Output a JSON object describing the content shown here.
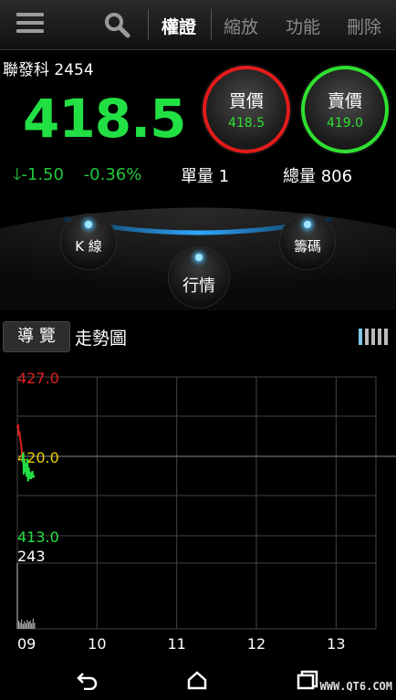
{
  "topbar": {
    "tabs": [
      {
        "label": "權證",
        "active": true
      },
      {
        "label": "縮放",
        "active": false
      },
      {
        "label": "功能",
        "active": false
      },
      {
        "label": "刪除",
        "active": false
      }
    ]
  },
  "quote": {
    "stock_name": "聯發科 2454",
    "price": "418.5",
    "change": "-1.50",
    "change_pct": "-0.36%",
    "single_volume": "單量 1",
    "total_volume": "總量 806",
    "price_color": "#22e044",
    "down_color": "#22c83c"
  },
  "buy": {
    "label": "買價",
    "value": "418.5",
    "ring_color": "#e31b1b"
  },
  "sell": {
    "label": "賣價",
    "value": "419.0",
    "ring_color": "#2fe02f"
  },
  "dial": {
    "kline": "K 線",
    "chips": "籌碼",
    "market": "行情"
  },
  "section": {
    "guide_label": "導 覽",
    "chart_title": "走勢圖"
  },
  "chart_data": {
    "type": "line",
    "x_ticks": [
      "09",
      "10",
      "11",
      "12",
      "13"
    ],
    "price_ticks": [
      {
        "label": "427.0",
        "value": 427.0,
        "color": "#e02020"
      },
      {
        "label": "420.0",
        "value": 420.0,
        "color": "#e8d000"
      },
      {
        "label": "413.0",
        "value": 413.0,
        "color": "#22e044"
      }
    ],
    "ylim": [
      413.0,
      427.0
    ],
    "reference_price": 420.0,
    "volume_max_label": "243",
    "price_series": [
      {
        "t": 0.0,
        "v": 422.5
      },
      {
        "t": 0.02,
        "v": 422.8
      },
      {
        "t": 0.04,
        "v": 421.8
      },
      {
        "t": 0.06,
        "v": 422.2
      },
      {
        "t": 0.08,
        "v": 421.5
      },
      {
        "t": 0.1,
        "v": 421.2
      },
      {
        "t": 0.12,
        "v": 420.6
      },
      {
        "t": 0.14,
        "v": 419.5
      },
      {
        "t": 0.16,
        "v": 420.3
      },
      {
        "t": 0.18,
        "v": 418.4
      },
      {
        "t": 0.2,
        "v": 419.6
      },
      {
        "t": 0.22,
        "v": 418.6
      },
      {
        "t": 0.24,
        "v": 419.4
      },
      {
        "t": 0.26,
        "v": 418.2
      },
      {
        "t": 0.28,
        "v": 419.8
      },
      {
        "t": 0.3,
        "v": 417.8
      },
      {
        "t": 0.32,
        "v": 419.0
      },
      {
        "t": 0.34,
        "v": 418.0
      },
      {
        "t": 0.36,
        "v": 418.6
      },
      {
        "t": 0.38,
        "v": 418.0
      },
      {
        "t": 0.4,
        "v": 418.4
      },
      {
        "t": 0.42,
        "v": 418.7
      },
      {
        "t": 0.44,
        "v": 418.1
      },
      {
        "t": 0.46,
        "v": 418.3
      },
      {
        "t": 0.48,
        "v": 418.2
      }
    ],
    "volume_series": [
      {
        "t": 0.0,
        "v": 243
      },
      {
        "t": 0.04,
        "v": 30
      },
      {
        "t": 0.08,
        "v": 22
      },
      {
        "t": 0.12,
        "v": 35
      },
      {
        "t": 0.16,
        "v": 18
      },
      {
        "t": 0.2,
        "v": 28
      },
      {
        "t": 0.24,
        "v": 20
      },
      {
        "t": 0.28,
        "v": 32
      },
      {
        "t": 0.32,
        "v": 25
      },
      {
        "t": 0.36,
        "v": 30
      },
      {
        "t": 0.4,
        "v": 20
      },
      {
        "t": 0.44,
        "v": 38
      },
      {
        "t": 0.48,
        "v": 22
      }
    ]
  },
  "navbar": {
    "back": "back-icon",
    "home": "home-icon",
    "recent": "recent-apps-icon"
  },
  "watermark": "WWW.QT6.COM"
}
